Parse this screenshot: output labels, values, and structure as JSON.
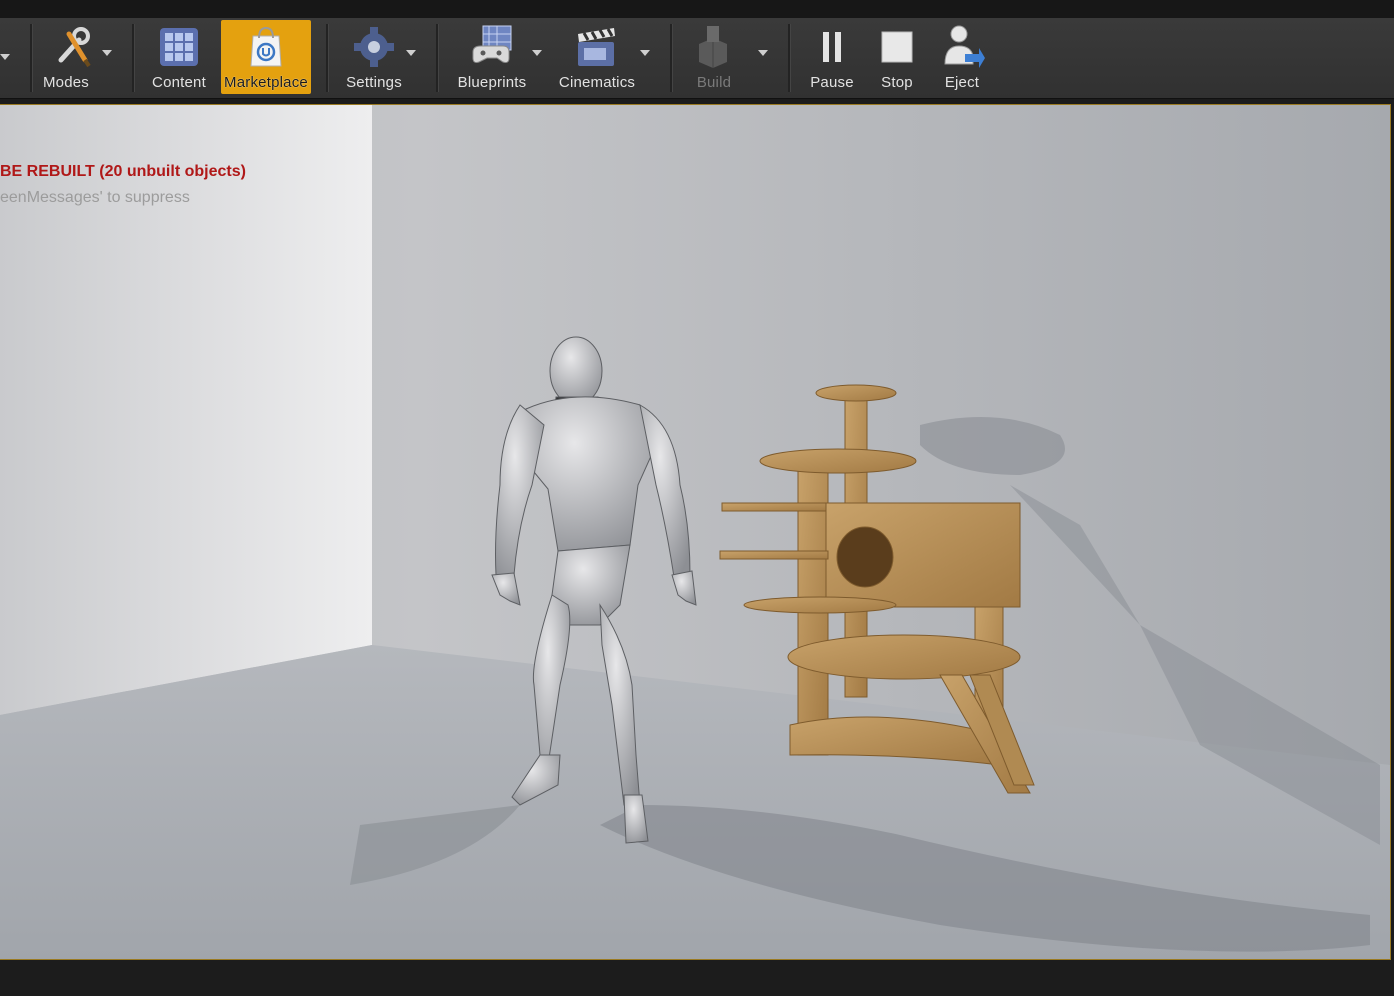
{
  "toolbar": {
    "modes_label": "Modes",
    "content_label": "Content",
    "marketplace_label": "Marketplace",
    "settings_label": "Settings",
    "blueprints_label": "Blueprints",
    "cinematics_label": "Cinematics",
    "build_label": "Build",
    "pause_label": "Pause",
    "stop_label": "Stop",
    "eject_label": "Eject",
    "active_item": "Marketplace",
    "disabled_items": [
      "Build"
    ],
    "icons": [
      "modes-icon",
      "content-icon",
      "marketplace-icon",
      "settings-icon",
      "blueprints-icon",
      "cinematics-icon",
      "build-icon",
      "pause-icon",
      "stop-icon",
      "eject-icon"
    ]
  },
  "viewport": {
    "error_message": "BE REBUILT (20 unbuilt objects)",
    "hint_message": "eenMessages' to suppress",
    "accent_color": "#e4a10f",
    "error_color": "#b01818"
  }
}
